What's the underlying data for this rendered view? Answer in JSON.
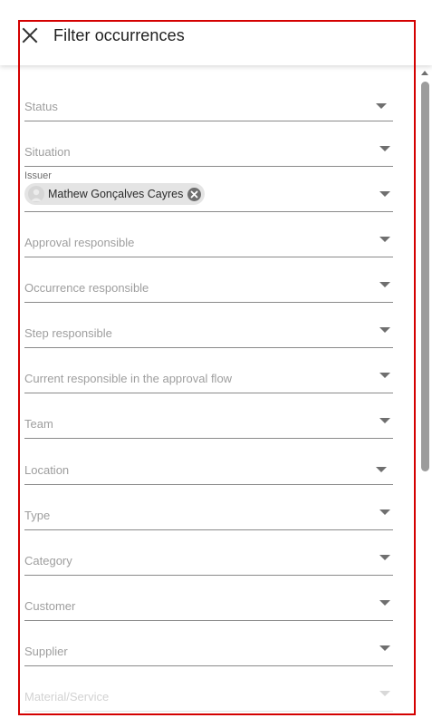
{
  "header": {
    "title": "Filter occurrences",
    "close_icon": "close-icon"
  },
  "filters": {
    "status": "Status",
    "situation": "Situation",
    "issuer": {
      "label": "Issuer",
      "chip_name": "Mathew Gonçalves Cayres"
    },
    "approval_responsible": "Approval responsible",
    "occurrence_responsible": "Occurrence responsible",
    "step_responsible": "Step responsible",
    "current_responsible": "Current responsible in the approval flow",
    "team": "Team",
    "location": "Location",
    "type": "Type",
    "category": "Category",
    "customer": "Customer",
    "supplier": "Supplier",
    "material_service": "Material/Service"
  },
  "colors": {
    "highlight_border": "#d40000",
    "underline": "#8a8a8a",
    "label": "#9e9e9e"
  }
}
